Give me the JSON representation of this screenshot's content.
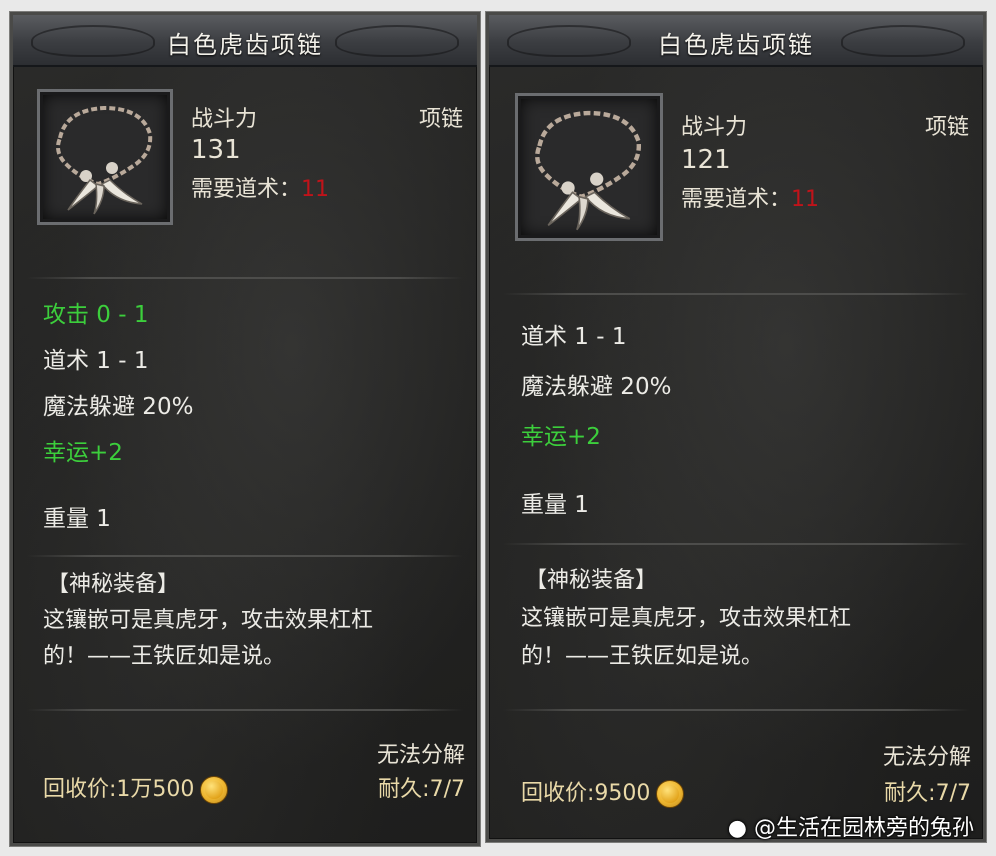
{
  "left": {
    "title": "白色虎齿项链",
    "power_label": "战斗力",
    "power_value": "131",
    "type": "项链",
    "requirement_label": "需要道术：",
    "requirement_value": "11",
    "stats": [
      {
        "text": "攻击 0 - 1",
        "color": "green"
      },
      {
        "text": "道术 1 - 1",
        "color": "white"
      },
      {
        "text": "魔法躲避 20%",
        "color": "white"
      },
      {
        "text": "幸运+2",
        "color": "green"
      }
    ],
    "weight": "重量 1",
    "mystery_header": "【神秘装备】",
    "description_line1": "这镶嵌可是真虎牙，攻击效果杠杠",
    "description_line2": "的！——王铁匠如是说。",
    "no_decompose": "无法分解",
    "recycle_price": "回收价:1万500",
    "durability": "耐久:7/7"
  },
  "right": {
    "title": "白色虎齿项链",
    "power_label": "战斗力",
    "power_value": "121",
    "type": "项链",
    "requirement_label": "需要道术：",
    "requirement_value": "11",
    "stats": [
      {
        "text": "道术 1 - 1",
        "color": "white"
      },
      {
        "text": "魔法躲避 20%",
        "color": "white"
      },
      {
        "text": "幸运+2",
        "color": "green"
      }
    ],
    "weight": "重量 1",
    "mystery_header": "【神秘装备】",
    "description_line1": "这镶嵌可是真虎牙，攻击效果杠杠",
    "description_line2": "的！——王铁匠如是说。",
    "no_decompose": "无法分解",
    "recycle_price": "回收价:9500",
    "durability": "耐久:7/7"
  },
  "watermark": "@生活在园林旁的兔孙",
  "colors": {
    "green_stat": "#3ccf3c",
    "red_requirement": "#c0131a",
    "gold_text": "#e9d9a8"
  },
  "icons": {
    "item": "tiger-tooth-necklace-icon",
    "currency": "gold-coin-icon",
    "watermark": "paw-icon"
  }
}
